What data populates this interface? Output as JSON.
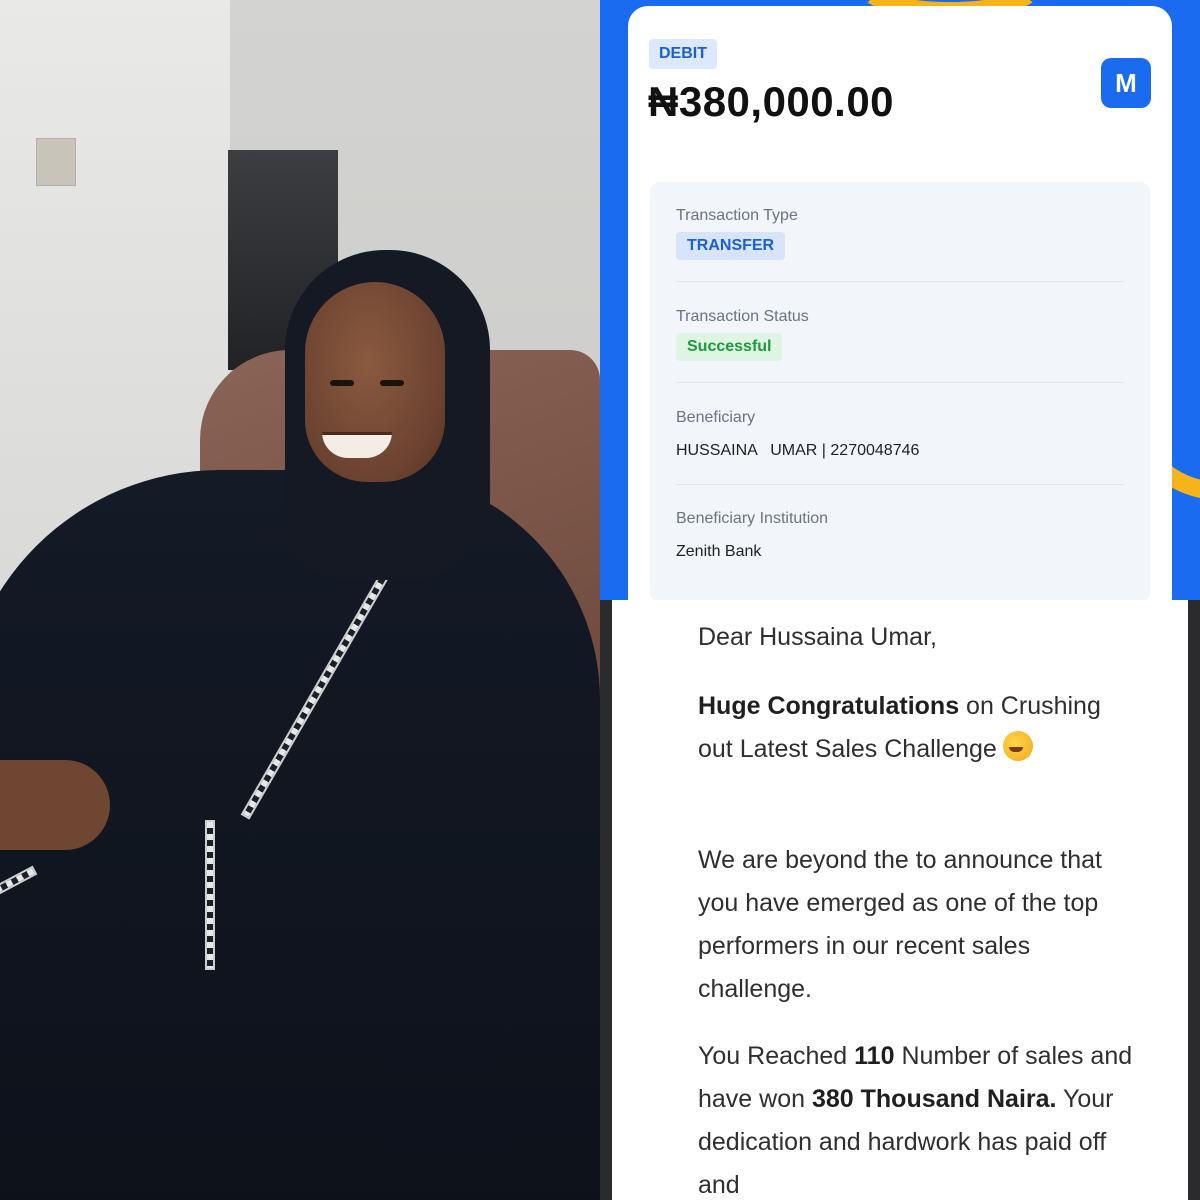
{
  "receipt": {
    "badge": "DEBIT",
    "amount": "₦380,000.00",
    "logo_letter": "M",
    "transaction_type_label": "Transaction Type",
    "transaction_type_value": "TRANSFER",
    "transaction_status_label": "Transaction Status",
    "transaction_status_value": "Successful",
    "beneficiary_label": "Beneficiary",
    "beneficiary_value": "HUSSAINA   UMAR | 2270048746",
    "institution_label": "Beneficiary Institution",
    "institution_value": "Zenith Bank",
    "colors": {
      "brand_blue": "#1a6bf0",
      "accent_yellow": "#f4b41a",
      "success_green": "#1f9a3a"
    }
  },
  "email": {
    "greeting": "Dear Hussaina Umar,",
    "p1_bold": "Huge Congratulations",
    "p1_rest": " on Crushing out Latest Sales Challenge",
    "p1_emoji": "partying-face-emoji",
    "p2": "We are beyond the to announce that you have emerged as one of the top performers in our recent sales challenge.",
    "p3_a": "You Reached ",
    "p3_b": "110",
    "p3_c": " Number of sales and have won ",
    "p3_d": "380 Thousand Naira.",
    "p3_e": " Your dedication and hardwork has paid off and"
  },
  "photo": {
    "subject": "woman-in-black-hijab-portrait"
  }
}
